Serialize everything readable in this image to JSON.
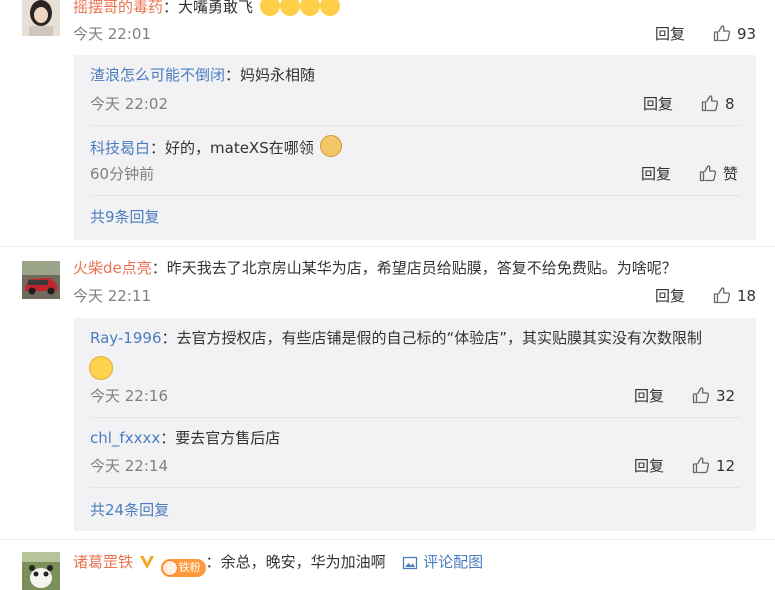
{
  "comments": [
    {
      "user": "摇摆哥的毒药",
      "text": "：大嘴勇敢飞",
      "time": "今天 22:01",
      "reply_label": "回复",
      "likes": "93",
      "replies": [
        {
          "user": "渣浪怎么可能不倒闭",
          "text": "：妈妈永相随",
          "time": "今天 22:02",
          "reply_label": "回复",
          "likes": "8"
        },
        {
          "user": "科技曷白",
          "text": "：好的，mateXS在哪领",
          "time": "60分钟前",
          "reply_label": "回复",
          "likes": "赞"
        }
      ],
      "more_replies": "共9条回复"
    },
    {
      "user": "火柴de点亮",
      "text": "：昨天我去了北京房山某华为店，希望店员给贴膜，答复不给免费贴。为啥呢？",
      "time": "今天 22:11",
      "reply_label": "回复",
      "likes": "18",
      "replies": [
        {
          "user": "Ray-1996",
          "text": "：去官方授权店，有些店铺是假的自己标的“体验店”，其实贴膜其实没有次数限制",
          "time": "今天 22:16",
          "reply_label": "回复",
          "likes": "32"
        },
        {
          "user": "chl_fxxxx",
          "text": "：要去官方售后店",
          "time": "今天 22:14",
          "reply_label": "回复",
          "likes": "12"
        }
      ],
      "more_replies": "共24条回复"
    },
    {
      "user": "诸葛罡铁",
      "badge_text": "铁粉",
      "text": "：余总，晚安，华为加油啊",
      "pic_link": "评论配图"
    }
  ],
  "colors": {
    "username": "#eb7350",
    "reply_username": "#4a7dbf",
    "time": "#808080",
    "reply_bg": "#f2f2f5"
  }
}
